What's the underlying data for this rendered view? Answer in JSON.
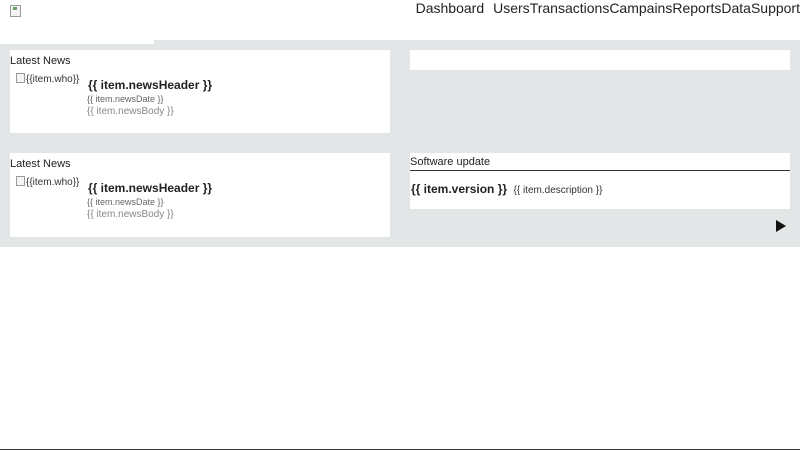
{
  "header": {
    "logo_icon": "broken-image-icon",
    "nav": [
      {
        "label": "Dashboard"
      },
      {
        "label": "Users"
      },
      {
        "label": "Transactions"
      },
      {
        "label": "Campains"
      },
      {
        "label": "Reports"
      },
      {
        "label": "Data"
      },
      {
        "label": "Support"
      }
    ]
  },
  "news_cards": [
    {
      "title": "Latest News",
      "avatar_alt": "{{item.who}}",
      "news_header": "{{ item.newsHeader }}",
      "news_date": "{{ item.newsDate }}",
      "news_body": "{{ item.newsBody }}"
    },
    {
      "title": "Latest News",
      "avatar_alt": "{{item.who}}",
      "news_header": "{{ item.newsHeader }}",
      "news_date": "{{ item.newsDate }}",
      "news_body": "{{ item.newsBody }}"
    }
  ],
  "software_update": {
    "title": "Software update",
    "version": "{{ item.version }}",
    "description": "{{ item.description }}"
  },
  "controls": {
    "next_icon": "play-icon"
  },
  "colors": {
    "content_background": "#e2e6e6",
    "card_background": "#ffffff",
    "text": "#222222",
    "muted_text": "#888888"
  }
}
